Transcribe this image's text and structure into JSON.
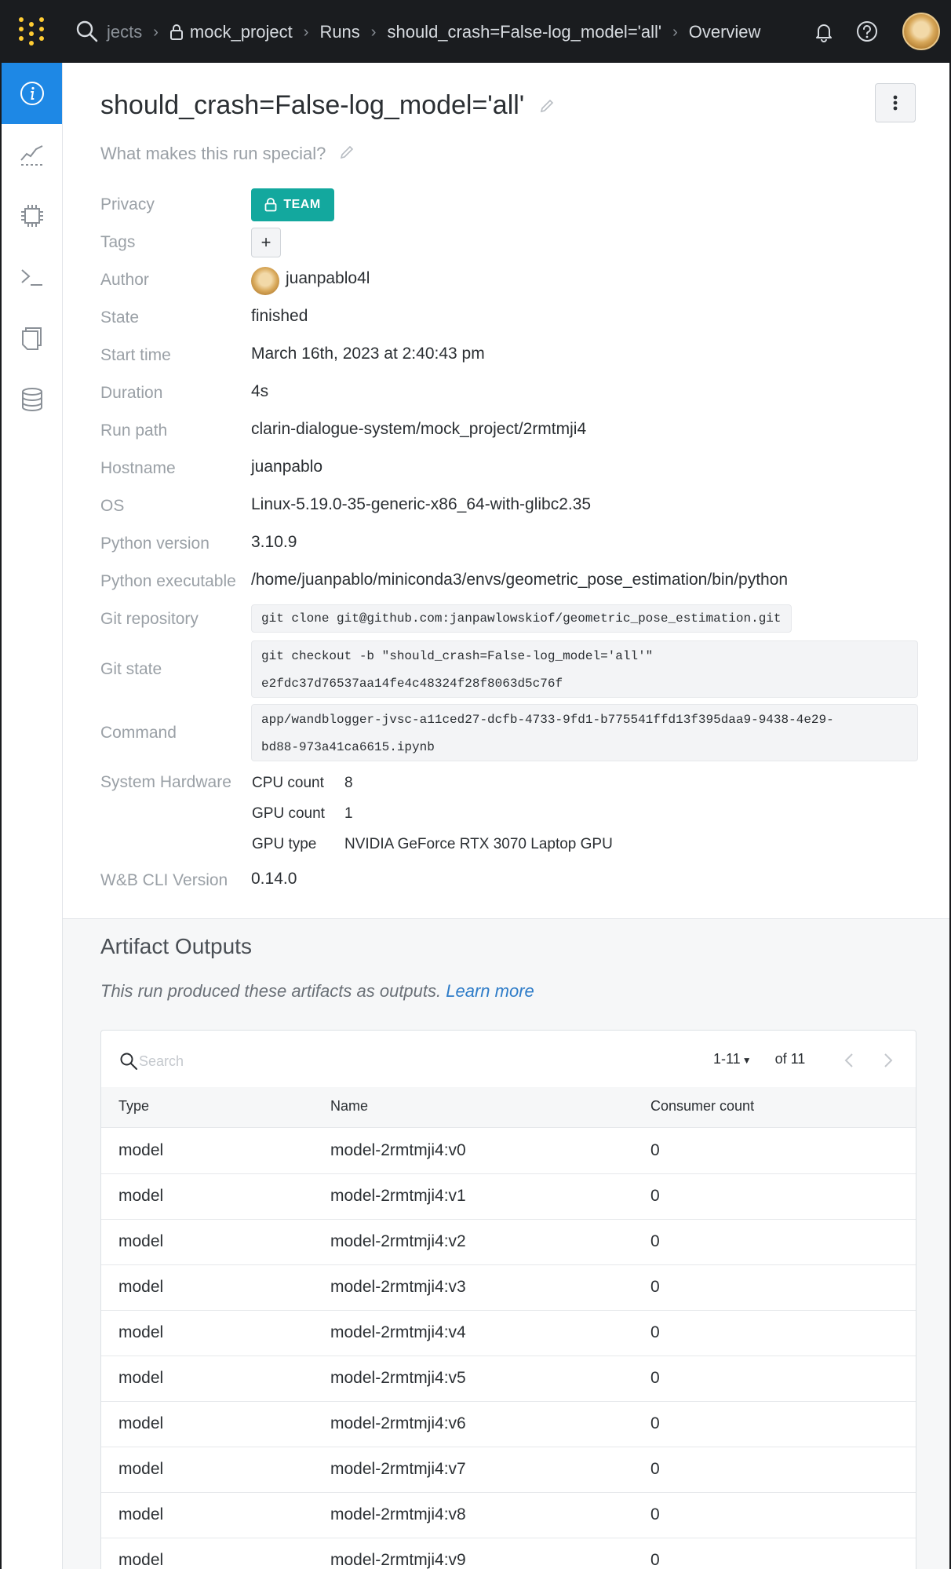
{
  "topnav": {
    "breadcrumbs": [
      {
        "label": "jects"
      },
      {
        "label": "mock_project"
      },
      {
        "label": "Runs"
      },
      {
        "label": "should_crash=False-log_model='all'"
      },
      {
        "label": "Overview"
      }
    ],
    "icons": [
      "wandb-logo-icon",
      "search-icon",
      "lock-icon",
      "bell-icon",
      "help-icon"
    ]
  },
  "sidebar": {
    "items": [
      {
        "name": "overview",
        "icon": "info-icon",
        "active": true
      },
      {
        "name": "charts",
        "icon": "chart-line-icon"
      },
      {
        "name": "system",
        "icon": "chip-icon"
      },
      {
        "name": "logs",
        "icon": "terminal-icon"
      },
      {
        "name": "files",
        "icon": "files-icon"
      },
      {
        "name": "artifacts",
        "icon": "database-icon"
      }
    ]
  },
  "run": {
    "title": "should_crash=False-log_model='all'",
    "description_placeholder": "What makes this run special?",
    "privacy_badge": "TEAM",
    "tags_add": "+",
    "author": "juanpablo4l",
    "state": "finished",
    "start_time": "March 16th, 2023 at 2:40:43 pm",
    "duration": "4s",
    "run_path": "clarin-dialogue-system/mock_project/2rmtmji4",
    "hostname": "juanpablo",
    "os": "Linux-5.19.0-35-generic-x86_64-with-glibc2.35",
    "python_version": "3.10.9",
    "python_executable": "/home/juanpablo/miniconda3/envs/geometric_pose_estimation/bin/python",
    "git_repository": "git clone git@github.com:janpawlowskiof/geometric_pose_estimation.git",
    "git_state_line1": "git checkout -b \"should_crash=False-log_model='all'\"",
    "git_state_line2": "e2fdc37d76537aa14fe4c48324f28f8063d5c76f",
    "command_line1": "app/wandblogger-jvsc-a11ced27-dcfb-4733-9fd1-b775541ffd13f395daa9-9438-4e29-",
    "command_line2": "bd88-973a41ca6615.ipynb",
    "cpu_count_label": "CPU count",
    "cpu_count": "8",
    "gpu_count_label": "GPU count",
    "gpu_count": "1",
    "gpu_type_label": "GPU type",
    "gpu_type": "NVIDIA GeForce RTX 3070 Laptop GPU",
    "cli_version": "0.14.0"
  },
  "labels": {
    "privacy": "Privacy",
    "tags": "Tags",
    "author": "Author",
    "state": "State",
    "start_time": "Start time",
    "duration": "Duration",
    "run_path": "Run path",
    "hostname": "Hostname",
    "os": "OS",
    "python_version": "Python version",
    "python_executable": "Python executable",
    "git_repository": "Git repository",
    "git_state": "Git state",
    "command": "Command",
    "system_hardware": "System Hardware",
    "cli_version": "W&B CLI Version"
  },
  "artifacts": {
    "title": "Artifact Outputs",
    "description": "This run produced these artifacts as outputs.",
    "learn_more": "Learn more",
    "search_placeholder": "Search",
    "pager_range": "1-11",
    "pager_total": "of 11",
    "columns": [
      "Type",
      "Name",
      "Consumer count"
    ],
    "rows": [
      {
        "type": "model",
        "name": "model-2rmtmji4:v0",
        "consumers": "0"
      },
      {
        "type": "model",
        "name": "model-2rmtmji4:v1",
        "consumers": "0"
      },
      {
        "type": "model",
        "name": "model-2rmtmji4:v2",
        "consumers": "0"
      },
      {
        "type": "model",
        "name": "model-2rmtmji4:v3",
        "consumers": "0"
      },
      {
        "type": "model",
        "name": "model-2rmtmji4:v4",
        "consumers": "0"
      },
      {
        "type": "model",
        "name": "model-2rmtmji4:v5",
        "consumers": "0"
      },
      {
        "type": "model",
        "name": "model-2rmtmji4:v6",
        "consumers": "0"
      },
      {
        "type": "model",
        "name": "model-2rmtmji4:v7",
        "consumers": "0"
      },
      {
        "type": "model",
        "name": "model-2rmtmji4:v8",
        "consumers": "0"
      },
      {
        "type": "model",
        "name": "model-2rmtmji4:v9",
        "consumers": "0"
      }
    ]
  },
  "colors": {
    "nav_bg": "#1a1c1f",
    "accent_blue": "#1e88e5",
    "team_badge": "#13a89e",
    "logo_yellow": "#ffcc33",
    "link": "#2e7cc8"
  }
}
